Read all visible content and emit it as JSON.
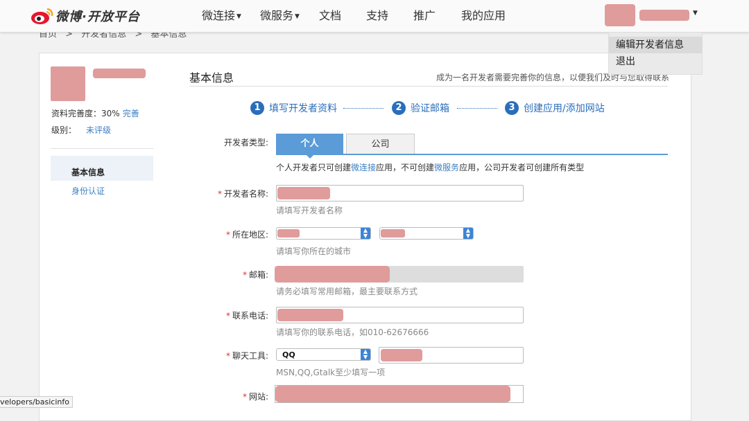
{
  "brand": {
    "logo_text": "微博·开放平台",
    "colors": {
      "accent": "#2a6ebb",
      "tab_active": "#5a9bd8",
      "link": "#3b7fc4",
      "required": "#dd3333",
      "redacted": "#e09b9b"
    }
  },
  "nav": {
    "items": [
      "微连接",
      "微服务",
      "文档",
      "支持",
      "推广",
      "我的应用"
    ]
  },
  "user_menu": {
    "items": [
      "编辑开发者信息",
      "退出"
    ]
  },
  "breadcrumb": {
    "items": [
      "首页",
      ">",
      "开发者信息",
      ">",
      "基本信息"
    ]
  },
  "profile": {
    "completeness_label": "资料完善度：",
    "completeness_value": "30%",
    "complete_link": "完善",
    "level_label": "级别：",
    "level_value": "未评级"
  },
  "sidebar": {
    "items": [
      "基本信息",
      "身份认证"
    ]
  },
  "section": {
    "title": "基本信息",
    "subtitle": "成为一名开发者需要完善你的信息，以便我们及时与您取得联系"
  },
  "steps": [
    {
      "num": "1",
      "label": "填写开发者资料"
    },
    {
      "num": "2",
      "label": "验证邮箱"
    },
    {
      "num": "3",
      "label": "创建应用/添加网站"
    }
  ],
  "form": {
    "dev_type_label": "开发者类型:",
    "tabs": [
      "个人",
      "公司"
    ],
    "note_parts": [
      "个人开发者只可创建",
      "微连接",
      "应用，不可创建",
      "微服务",
      "应用，公司开发者可创建所有类型"
    ],
    "fields": {
      "name": {
        "label": "开发者名称:",
        "hint": "请填写开发者名称"
      },
      "region": {
        "label": "所在地区:",
        "hint": "请填写你所在的城市"
      },
      "email": {
        "label": "邮箱:",
        "hint": "请务必填写常用邮箱，最主要联系方式"
      },
      "phone": {
        "label": "联系电话:",
        "hint": "请填写你的联系电话，如010-62676666"
      },
      "chat": {
        "label": "聊天工具:",
        "select_value": "QQ",
        "hint": "MSN,QQ,Gtalk至少填写一项"
      },
      "website": {
        "label": "网站:"
      }
    },
    "required_mark": "*"
  },
  "status_url": "velopers/basicinfo"
}
